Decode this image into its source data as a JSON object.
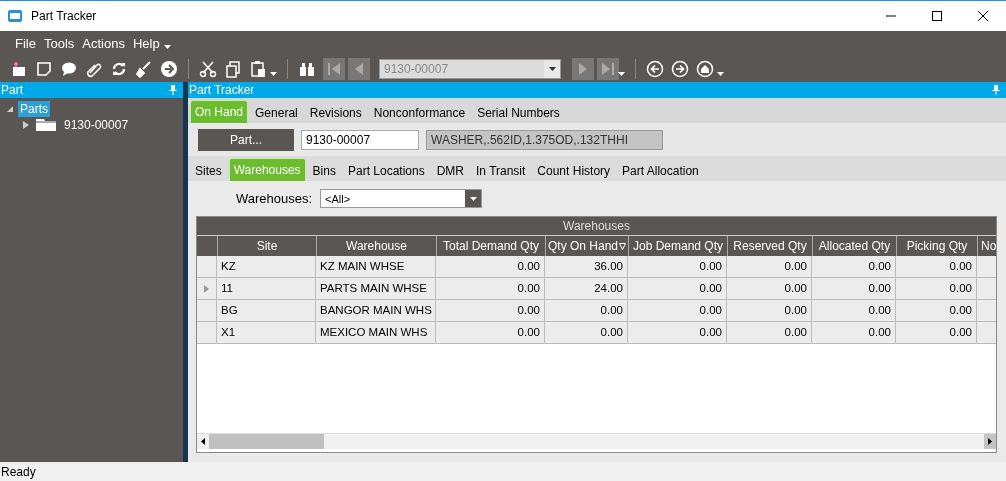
{
  "window": {
    "title": "Part Tracker"
  },
  "menu": [
    {
      "label": "File"
    },
    {
      "label": "Tools"
    },
    {
      "label": "Actions"
    },
    {
      "label": "Help"
    }
  ],
  "toolbar": {
    "record_value": "9130-00007"
  },
  "left_panel": {
    "title": "Part",
    "tree": [
      {
        "label": "Parts",
        "selected": true,
        "expanded": true,
        "children": [
          {
            "label": "9130-00007",
            "selected": false,
            "expanded": false
          }
        ]
      }
    ]
  },
  "main_panel": {
    "title": "Part Tracker",
    "tabs": [
      {
        "label": "On Hand",
        "selected": true
      },
      {
        "label": "General",
        "selected": false
      },
      {
        "label": "Revisions",
        "selected": false
      },
      {
        "label": "Nonconformance",
        "selected": false
      },
      {
        "label": "Serial Numbers",
        "selected": false
      }
    ],
    "part_button": "Part...",
    "part_number": "9130-00007",
    "part_description": "WASHER,.562ID,1.375OD,.132THHI",
    "subtabs": [
      {
        "label": "Sites",
        "selected": false
      },
      {
        "label": "Warehouses",
        "selected": true
      },
      {
        "label": "Bins",
        "selected": false
      },
      {
        "label": "Part Locations",
        "selected": false
      },
      {
        "label": "DMR",
        "selected": false
      },
      {
        "label": "In Transit",
        "selected": false
      },
      {
        "label": "Count History",
        "selected": false
      },
      {
        "label": "Part Allocation",
        "selected": false
      }
    ],
    "filter": {
      "label": "Warehouses:",
      "value": "<All>"
    },
    "grid": {
      "title": "Warehouses",
      "columns": [
        {
          "label": "Site",
          "sorted": false
        },
        {
          "label": "Warehouse",
          "sorted": false
        },
        {
          "label": "Total Demand Qty",
          "sorted": false
        },
        {
          "label": "Qty On Hand",
          "sorted": true
        },
        {
          "label": "Job Demand Qty",
          "sorted": false
        },
        {
          "label": "Reserved Qty",
          "sorted": false
        },
        {
          "label": "Allocated Qty",
          "sorted": false
        },
        {
          "label": "Picking Qty",
          "sorted": false
        },
        {
          "label": "No"
        }
      ],
      "rows": [
        {
          "current": false,
          "cells": [
            "KZ",
            "KZ MAIN WHSE",
            "0.00",
            "36.00",
            "0.00",
            "0.00",
            "0.00",
            "0.00"
          ]
        },
        {
          "current": true,
          "cells": [
            "11",
            "PARTS MAIN WHSE",
            "0.00",
            "24.00",
            "0.00",
            "0.00",
            "0.00",
            "0.00"
          ]
        },
        {
          "current": false,
          "cells": [
            "BG",
            "BANGOR MAIN WHS",
            "0.00",
            "0.00",
            "0.00",
            "0.00",
            "0.00",
            "0.00"
          ]
        },
        {
          "current": false,
          "cells": [
            "X1",
            "MEXICO MAIN WHS",
            "0.00",
            "0.00",
            "0.00",
            "0.00",
            "0.00",
            "0.00"
          ]
        }
      ]
    }
  },
  "status_bar": "Ready"
}
